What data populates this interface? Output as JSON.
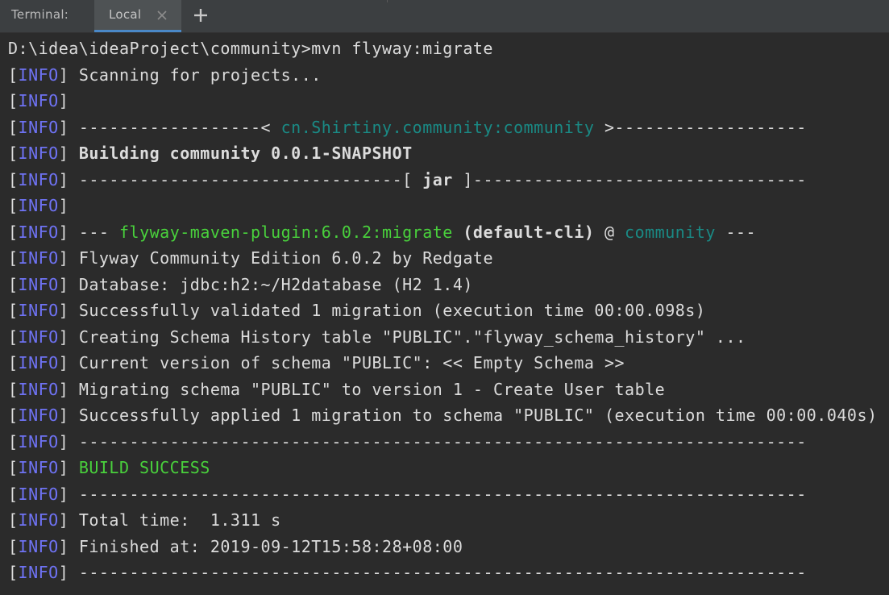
{
  "tabbar": {
    "label": "Terminal:",
    "tab_label": "Local",
    "close_icon": "close-icon",
    "add_icon": "plus-icon"
  },
  "terminal": {
    "prompt": "D:\\idea\\ideaProject\\community>mvn flyway:migrate",
    "level_label": "INFO",
    "open_bracket": "[",
    "close_bracket": "]",
    "lines": {
      "l1": "Scanning for projects...",
      "l2": "",
      "l3_pre": "------------------< ",
      "l3_artifact": "cn.Shirtiny.community:community",
      "l3_post": " >-------------------",
      "l4": "Building community 0.0.1-SNAPSHOT",
      "l5_pre": "--------------------------------[ ",
      "l5_pkg": "jar",
      "l5_post": " ]---------------------------------",
      "l6": "",
      "l7_pre": "--- ",
      "l7_plugin": "flyway-maven-plugin:6.0.2:migrate",
      "l7_exec": " (default-cli)",
      "l7_at": " @ ",
      "l7_project": "community",
      "l7_post": " ---",
      "l8": "Flyway Community Edition 6.0.2 by Redgate",
      "l9": "Database: jdbc:h2:~/H2database (H2 1.4)",
      "l10": "Successfully validated 1 migration (execution time 00:00.098s)",
      "l11": "Creating Schema History table \"PUBLIC\".\"flyway_schema_history\" ...",
      "l12": "Current version of schema \"PUBLIC\": << Empty Schema >>",
      "l13": "Migrating schema \"PUBLIC\" to version 1 - Create User table",
      "l14": "Successfully applied 1 migration to schema \"PUBLIC\" (execution time 00:00.040s)",
      "l15": "------------------------------------------------------------------------",
      "l16": "BUILD SUCCESS",
      "l17": "------------------------------------------------------------------------",
      "l18": "Total time:  1.311 s",
      "l19": "Finished at: 2019-09-12T15:58:28+08:00",
      "l20": "------------------------------------------------------------------------"
    }
  },
  "colors": {
    "background": "#2b2b2b",
    "tabbar": "#3c3f41",
    "active_tab": "#4e5254",
    "tab_underline": "#4a88c7",
    "text": "#dcdcdc",
    "info_level": "#6f73f5",
    "artifact_teal": "#1a8a85",
    "success_green": "#49d13c"
  }
}
